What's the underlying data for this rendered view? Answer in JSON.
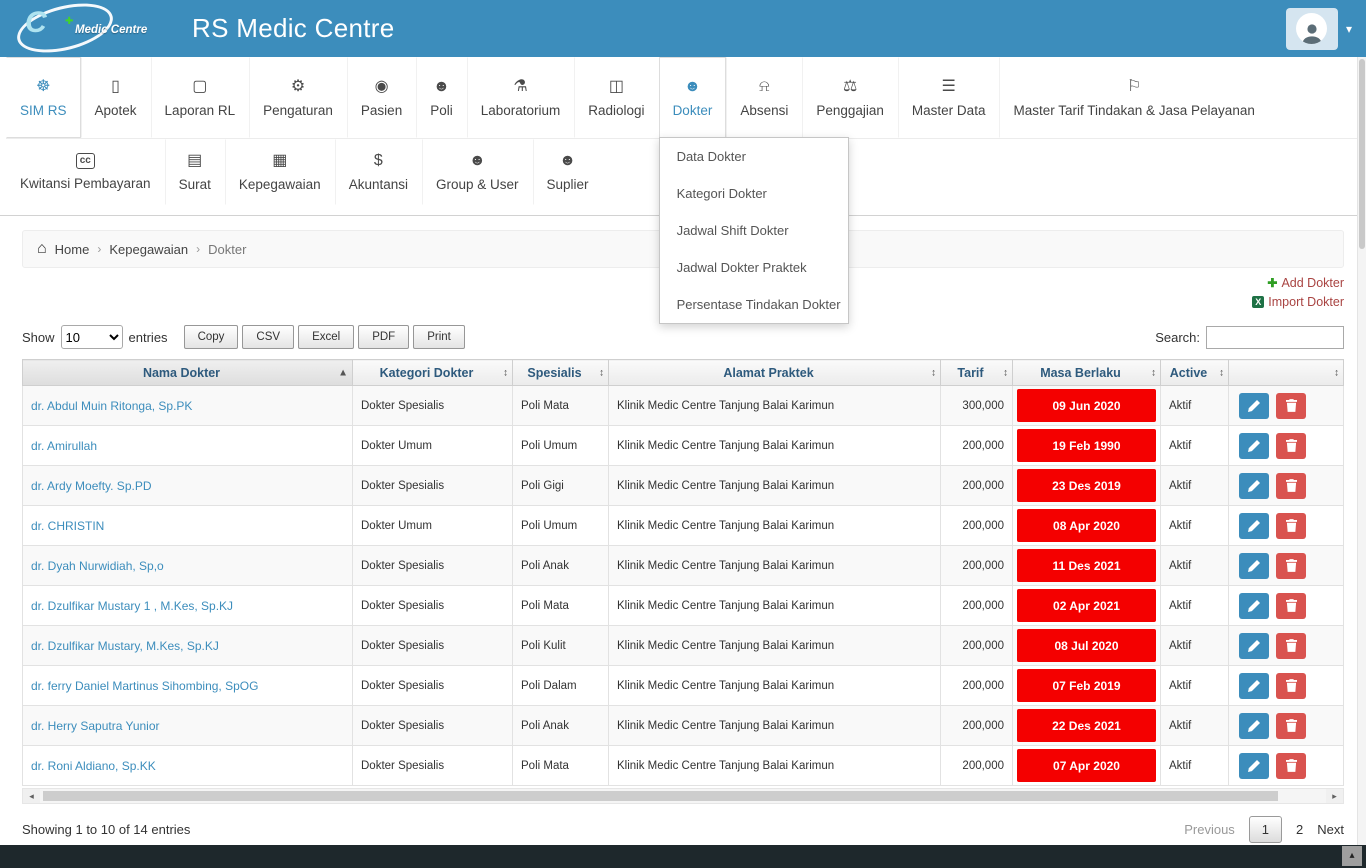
{
  "header": {
    "title": "RS Medic Centre",
    "logo_text": "Medic Centre"
  },
  "icons": {
    "home": "⌂",
    "plus": "✚",
    "excel_letter": "X",
    "caret_down": "▾",
    "sort_asc": "▲",
    "sort_both": "↕",
    "breadcrumb_separator": "›",
    "scroll_left": "◂",
    "scroll_right": "▸",
    "back_to_top": "▴",
    "logo_swirl": "C"
  },
  "colors": {
    "header_blue": "#3c8dbc",
    "badge_red": "#f40000",
    "edit_blue": "#3c8dbc",
    "delete_red": "#d9534f",
    "excel_green": "#1e7145",
    "plus_green": "#2f9e23"
  },
  "nav": {
    "row1": [
      {
        "id": "sim-rs",
        "label": "SIM RS",
        "icon": "☸",
        "state": "active"
      },
      {
        "id": "apotek",
        "label": "Apotek",
        "icon": "▯"
      },
      {
        "id": "laporan-rl",
        "label": "Laporan RL",
        "icon": "▢"
      },
      {
        "id": "pengaturan",
        "label": "Pengaturan",
        "icon": "⚙"
      },
      {
        "id": "pasien",
        "label": "Pasien",
        "icon": "◉"
      },
      {
        "id": "poli",
        "label": "Poli",
        "icon": "☻"
      },
      {
        "id": "laboratorium",
        "label": "Laboratorium",
        "icon": "⚗"
      },
      {
        "id": "radiologi",
        "label": "Radiologi",
        "icon": "◫"
      },
      {
        "id": "dokter",
        "label": "Dokter",
        "icon": "☻",
        "state": "open"
      },
      {
        "id": "absensi",
        "label": "Absensi",
        "icon": "⍾"
      },
      {
        "id": "penggajian",
        "label": "Penggajian",
        "icon": "⚖"
      },
      {
        "id": "master-data",
        "label": "Master Data",
        "icon": "☰"
      },
      {
        "id": "master-tarif",
        "label": "Master Tarif Tindakan & Jasa Pelayanan",
        "icon": "⚐"
      }
    ],
    "row2": [
      {
        "id": "kwitansi-pembayaran",
        "label": "Kwitansi Pembayaran",
        "icon": "cc",
        "icon_style": "cc-box"
      },
      {
        "id": "surat",
        "label": "Surat",
        "icon": "▤"
      },
      {
        "id": "kepegawaian",
        "label": "Kepegawaian",
        "icon": "▦"
      },
      {
        "id": "akuntansi",
        "label": "Akuntansi",
        "icon": "$"
      },
      {
        "id": "group-user",
        "label": "Group & User",
        "icon": "☻"
      },
      {
        "id": "suplier",
        "label": "Suplier",
        "icon": "☻"
      }
    ]
  },
  "dokter_menu": [
    "Data Dokter",
    "Kategori Dokter",
    "Jadwal Shift Dokter",
    "Jadwal Dokter Praktek",
    "Persentase Tindakan Dokter"
  ],
  "breadcrumb": [
    "Home",
    "Kepegawaian",
    "Dokter"
  ],
  "page_actions": {
    "add": "Add Dokter",
    "import": "Import Dokter"
  },
  "table_controls": {
    "show_label": "Show",
    "entries_value": "10",
    "entries_label": "entries",
    "buttons": [
      "Copy",
      "CSV",
      "Excel",
      "PDF",
      "Print"
    ],
    "search_label": "Search:",
    "search_value": ""
  },
  "table": {
    "columns": [
      {
        "label": "Nama Dokter",
        "sort": "asc"
      },
      {
        "label": "Kategori Dokter"
      },
      {
        "label": "Spesialis"
      },
      {
        "label": "Alamat Praktek"
      },
      {
        "label": "Tarif"
      },
      {
        "label": "Masa Berlaku"
      },
      {
        "label": "Active"
      },
      {
        "label": ""
      }
    ],
    "rows": [
      {
        "name": "dr. Abdul Muin Ritonga, Sp.PK",
        "category": "Dokter Spesialis",
        "specialist": "Poli Mata",
        "address": "Klinik Medic Centre Tanjung Balai Karimun",
        "tarif": "300,000",
        "valid_until": "09 Jun 2020",
        "active": "Aktif"
      },
      {
        "name": "dr. Amirullah",
        "category": "Dokter Umum",
        "specialist": "Poli Umum",
        "address": "Klinik Medic Centre Tanjung Balai Karimun",
        "tarif": "200,000",
        "valid_until": "19 Feb 1990",
        "active": "Aktif"
      },
      {
        "name": "dr. Ardy Moefty. Sp.PD",
        "category": "Dokter Spesialis",
        "specialist": "Poli Gigi",
        "address": "Klinik Medic Centre Tanjung Balai Karimun",
        "tarif": "200,000",
        "valid_until": "23 Des 2019",
        "active": "Aktif"
      },
      {
        "name": "dr. CHRISTIN",
        "category": "Dokter Umum",
        "specialist": "Poli Umum",
        "address": "Klinik Medic Centre Tanjung Balai Karimun",
        "tarif": "200,000",
        "valid_until": "08 Apr 2020",
        "active": "Aktif"
      },
      {
        "name": "dr. Dyah Nurwidiah, Sp,o",
        "category": "Dokter Spesialis",
        "specialist": "Poli Anak",
        "address": "Klinik Medic Centre Tanjung Balai Karimun",
        "tarif": "200,000",
        "valid_until": "11 Des 2021",
        "active": "Aktif"
      },
      {
        "name": "dr. Dzulfikar Mustary 1 , M.Kes, Sp.KJ",
        "category": "Dokter Spesialis",
        "specialist": "Poli Mata",
        "address": "Klinik Medic Centre Tanjung Balai Karimun",
        "tarif": "200,000",
        "valid_until": "02 Apr 2021",
        "active": "Aktif"
      },
      {
        "name": "dr. Dzulfikar Mustary, M.Kes, Sp.KJ",
        "category": "Dokter Spesialis",
        "specialist": "Poli Kulit",
        "address": "Klinik Medic Centre Tanjung Balai Karimun",
        "tarif": "200,000",
        "valid_until": "08 Jul 2020",
        "active": "Aktif"
      },
      {
        "name": "dr. ferry Daniel Martinus Sihombing, SpOG",
        "category": "Dokter Spesialis",
        "specialist": "Poli Dalam",
        "address": "Klinik Medic Centre Tanjung Balai Karimun",
        "tarif": "200,000",
        "valid_until": "07 Feb 2019",
        "active": "Aktif"
      },
      {
        "name": "dr. Herry Saputra Yunior",
        "category": "Dokter Spesialis",
        "specialist": "Poli Anak",
        "address": "Klinik Medic Centre Tanjung Balai Karimun",
        "tarif": "200,000",
        "valid_until": "22 Des 2021",
        "active": "Aktif"
      },
      {
        "name": "dr. Roni Aldiano, Sp.KK",
        "category": "Dokter Spesialis",
        "specialist": "Poli Mata",
        "address": "Klinik Medic Centre Tanjung Balai Karimun",
        "tarif": "200,000",
        "valid_until": "07 Apr 2020",
        "active": "Aktif"
      }
    ]
  },
  "footer": {
    "showing": "Showing 1 to 10 of 14 entries",
    "pagination": {
      "previous": "Previous",
      "page1": "1",
      "page2": "2",
      "next": "Next"
    }
  }
}
